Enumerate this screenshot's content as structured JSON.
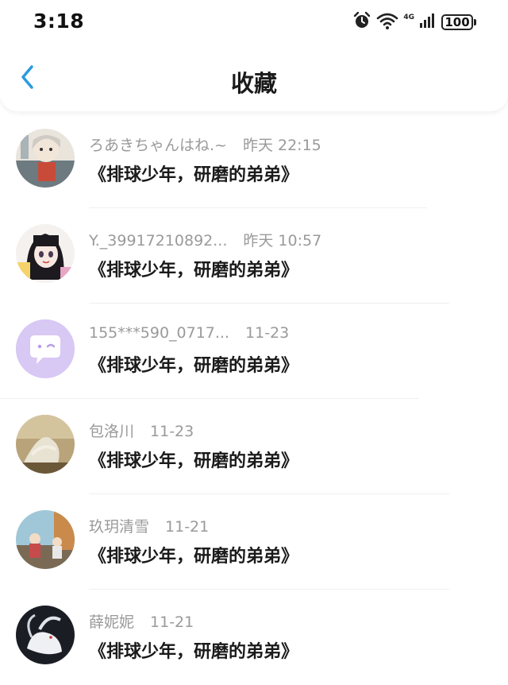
{
  "status_bar": {
    "time": "3:18",
    "network": "4G",
    "battery": "100"
  },
  "header": {
    "title": "收藏"
  },
  "items": [
    {
      "user": "ろあきちゃんはね.~",
      "time": "昨天 22:15",
      "content": "《排球少年，研磨的弟弟》",
      "avatar": "anime-avatar-1"
    },
    {
      "user": "Y._39917210892...",
      "time": "昨天 10:57",
      "content": "《排球少年，研磨的弟弟》",
      "avatar": "anime-avatar-2"
    },
    {
      "user": "155***590_0717...",
      "time": "11-23",
      "content": "《排球少年，研磨的弟弟》",
      "avatar": "default-chat-avatar"
    },
    {
      "user": "包洛川",
      "time": "11-23",
      "content": "《排球少年，研磨的弟弟》",
      "avatar": "art-avatar-1"
    },
    {
      "user": "玖玥清雪",
      "time": "11-21",
      "content": "《排球少年，研磨的弟弟》",
      "avatar": "art-avatar-2"
    },
    {
      "user": "薛妮妮",
      "time": "11-21",
      "content": "《排球少年，研磨的弟弟》",
      "avatar": "art-avatar-3"
    }
  ],
  "colors": {
    "accent": "#2a9be0",
    "meta_text": "#9a9a9a",
    "default_avatar_bg": "#d8c8f4"
  }
}
